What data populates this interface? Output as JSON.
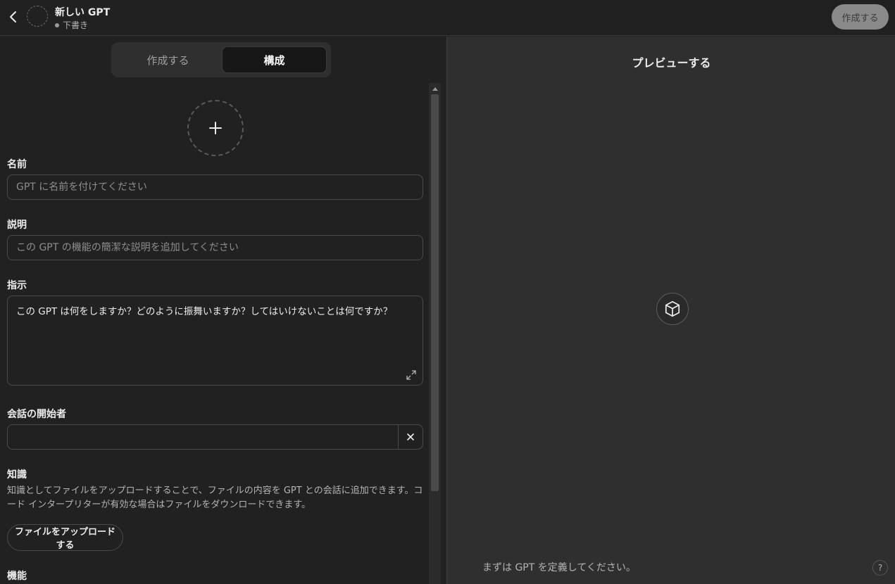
{
  "header": {
    "title": "新しい GPT",
    "status": "下書き",
    "create_button": "作成する"
  },
  "tabs": [
    {
      "label": "作成する",
      "active": false
    },
    {
      "label": "構成",
      "active": true
    }
  ],
  "form": {
    "name": {
      "label": "名前",
      "placeholder": "GPT に名前を付けてください"
    },
    "description": {
      "label": "説明",
      "placeholder": "この GPT の機能の簡潔な説明を追加してください"
    },
    "instructions": {
      "label": "指示",
      "placeholder": "この GPT は何をしますか？どのように振舞いますか？してはいけないことは何ですか？"
    },
    "conversation_starters": {
      "label": "会話の開始者",
      "value": ""
    },
    "knowledge": {
      "label": "知識",
      "description": "知識としてファイルをアップロードすることで、ファイルの内容を GPT との会話に追加できます。コード インタープリターが有効な場合はファイルをダウンロードできます。",
      "upload_button": "ファイルをアップロードする"
    },
    "capabilities": {
      "label": "機能"
    }
  },
  "preview": {
    "title": "プレビューする",
    "hint": "まずは GPT を定義してください。",
    "help": "?"
  },
  "colors": {
    "background": "#212121",
    "preview_background": "#2f2f2f",
    "border": "#4a4a4a",
    "text": "#ececec",
    "muted_text": "#b4b4b4"
  },
  "icons": [
    "back-chevron-icon",
    "plus-icon",
    "expand-icon",
    "close-icon",
    "cube-icon",
    "help-icon"
  ]
}
